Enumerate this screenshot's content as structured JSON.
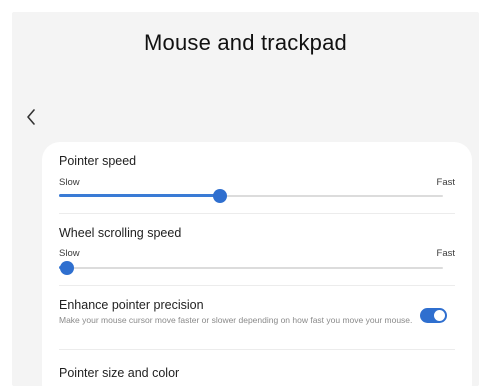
{
  "header": {
    "title": "Mouse and trackpad",
    "back_icon": "chevron-left-icon"
  },
  "settings": {
    "pointer_speed": {
      "label": "Pointer speed",
      "min_label": "Slow",
      "max_label": "Fast",
      "value_fraction": 0.42
    },
    "wheel_scrolling_speed": {
      "label": "Wheel scrolling speed",
      "min_label": "Slow",
      "max_label": "Fast",
      "value_fraction": 0.02
    },
    "enhance_pointer_precision": {
      "label": "Enhance pointer precision",
      "description": "Make your mouse cursor move faster or slower depending on how fast you move your mouse.",
      "enabled": true
    },
    "pointer_size_and_color": {
      "label": "Pointer size and color"
    }
  },
  "colors": {
    "accent": "#2f6fcf",
    "background": "#f4f4f4",
    "card": "#ffffff"
  }
}
